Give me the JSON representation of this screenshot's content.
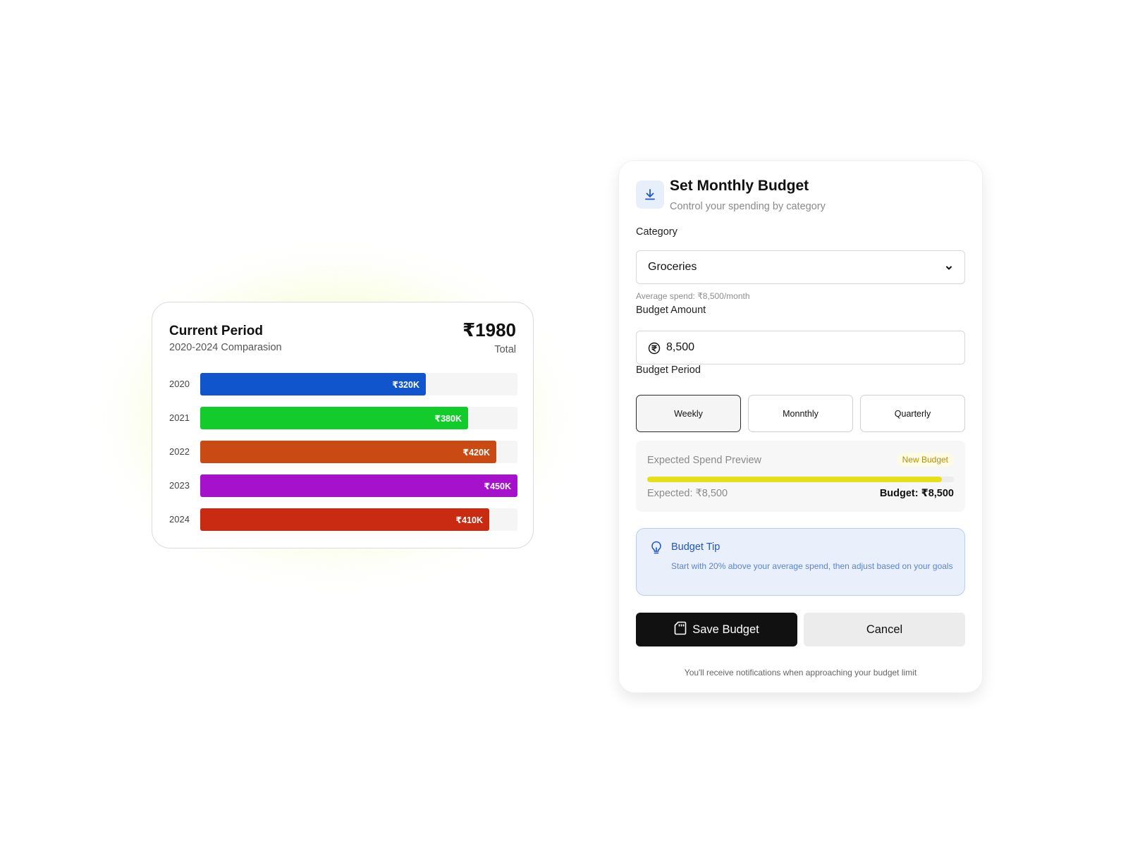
{
  "chart_card": {
    "title": "Current Period",
    "subtitle": "2020-2024 Comparasion",
    "total_value": "₹1980",
    "total_label": "Total"
  },
  "chart_data": {
    "type": "bar",
    "orientation": "horizontal",
    "title": "Current Period",
    "subtitle": "2020-2024 Comparasion",
    "categories": [
      "2020",
      "2021",
      "2022",
      "2023",
      "2024"
    ],
    "values": [
      320,
      380,
      420,
      450,
      410
    ],
    "value_labels": [
      "₹320K",
      "₹380K",
      "₹420K",
      "₹450K",
      "₹410K"
    ],
    "colors": [
      "#1155cc",
      "#13cc2c",
      "#c94a13",
      "#a612cc",
      "#c82a12"
    ],
    "xlim": [
      0,
      450
    ],
    "grid": false
  },
  "budget_form": {
    "title": "Set Monthly Budget",
    "subtitle": "Control your spending by category",
    "header_icon": "download-icon",
    "category": {
      "label": "Category",
      "selected": "Groceries",
      "hint": "Average spend: ₹8,500/month"
    },
    "amount": {
      "label": "Budget Amount",
      "value": "8,500",
      "icon": "rupee-icon"
    },
    "period": {
      "label": "Budget Period",
      "options": [
        "Weekly",
        "Monnthly",
        "Quarterly"
      ],
      "selected": "Weekly"
    },
    "preview": {
      "title": "Expected Spend Preview",
      "badge": "New Budget",
      "expected": "Expected: ₹8,500",
      "budget": "Budget: ₹8,500",
      "progress_fraction": 0.96
    },
    "tip": {
      "title": "Budget Tip",
      "text": "Start with 20% above your average spend, then adjust based on your goals",
      "icon": "lightbulb-icon"
    },
    "save_label": "Save Budget",
    "save_icon": "sd-card-icon",
    "cancel_label": "Cancel",
    "footer": "You'll receive notifications when approaching your budget limit"
  },
  "colors": {
    "accent_blue": "#1e55c4",
    "primary_button": "#111111",
    "progress_fill": "#e6df1e",
    "badge_text": "#b08f16"
  }
}
